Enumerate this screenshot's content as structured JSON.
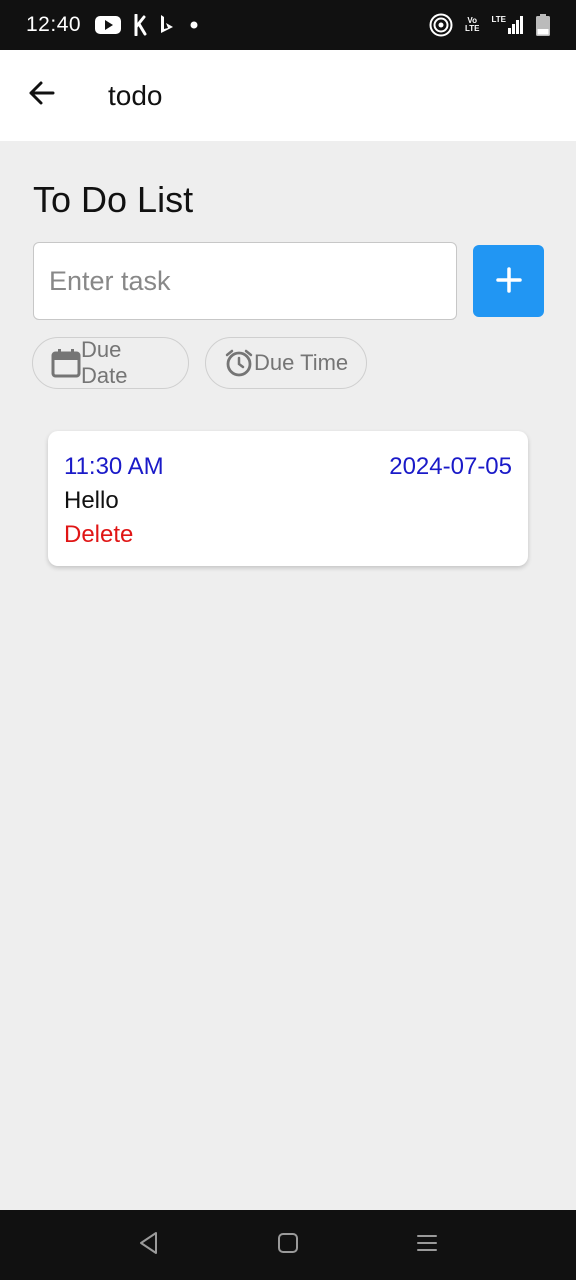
{
  "status_bar": {
    "time": "12:40",
    "icons": [
      "youtube-icon",
      "app-k-icon",
      "bing-icon",
      "dot-icon",
      "hotspot-icon",
      "volte-icon",
      "lte-signal-icon",
      "battery-icon"
    ],
    "volte_top": "Vo",
    "volte_bottom": "LTE",
    "lte_label": "LTE"
  },
  "app_bar": {
    "back_icon": "arrow-left-icon",
    "title": "todo"
  },
  "main": {
    "heading": "To Do List",
    "task_input": {
      "value": "",
      "placeholder": "Enter task"
    },
    "add_button_icon": "plus-icon",
    "due_date_label": "Due Date",
    "due_time_label": "Due Time"
  },
  "tasks": [
    {
      "time": "11:30 AM",
      "date": "2024-07-05",
      "text": "Hello",
      "delete_label": "Delete"
    }
  ],
  "nav_bar": {
    "icons": [
      "back-triangle-icon",
      "home-square-icon",
      "menu-lines-icon"
    ]
  },
  "colors": {
    "accent": "#2196f3",
    "task_meta": "#1a1ac8",
    "delete": "#e01515",
    "background": "#eeeeee"
  }
}
